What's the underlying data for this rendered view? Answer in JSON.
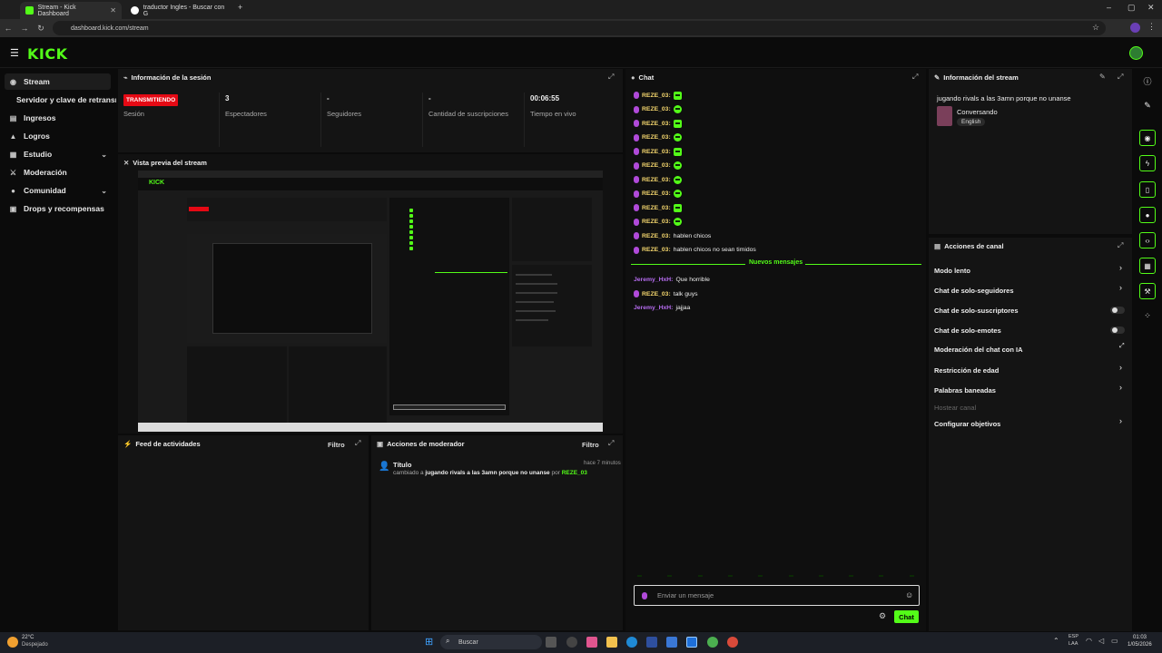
{
  "browser": {
    "tabs": [
      {
        "title": "Stream - Kick Dashboard",
        "active": true
      },
      {
        "title": "traductor Ingles - Buscar con G",
        "active": false
      }
    ],
    "url": "dashboard.kick.com/stream"
  },
  "app": {
    "logo": "KICK"
  },
  "sidebar": {
    "items": [
      {
        "label": "Stream",
        "icon": "broadcast-icon",
        "active": true
      },
      {
        "label": "Servidor y clave de retransmisión",
        "icon": "",
        "active": false
      },
      {
        "label": "Ingresos",
        "icon": "wallet-icon"
      },
      {
        "label": "Logros",
        "icon": "trophy-icon"
      },
      {
        "label": "Estudio",
        "icon": "studio-icon",
        "chevron": true
      },
      {
        "label": "Moderación",
        "icon": "sword-icon"
      },
      {
        "label": "Comunidad",
        "icon": "people-icon",
        "chevron": true
      },
      {
        "label": "Drops y recompensas",
        "icon": "gift-icon"
      }
    ]
  },
  "session": {
    "title": "Información de la sesión",
    "status_badge": "TRANSMITIENDO",
    "status_label": "Sesión",
    "stats": [
      {
        "value": "3",
        "label": "Espectadores"
      },
      {
        "value": "-",
        "label": "Seguidores"
      },
      {
        "value": "-",
        "label": "Cantidad de suscripciones"
      },
      {
        "value": "00:06:55",
        "label": "Tiempo en vivo"
      }
    ]
  },
  "preview": {
    "title": "Vista previa del stream"
  },
  "activity": {
    "title": "Feed de actividades",
    "filter": "Filtro"
  },
  "modactions": {
    "title": "Acciones de moderador",
    "filter": "Filtro",
    "entry": {
      "heading": "Título",
      "time": "hace 7 minutos",
      "prefix": "cambiado a",
      "value": "jugando rivals a las 3amn porque no unanse",
      "by": "por",
      "user": "REZE_03"
    }
  },
  "chat": {
    "title": "Chat",
    "messages": [
      {
        "user": "REZE_03:",
        "text": "",
        "emote": "sq"
      },
      {
        "user": "REZE_03:",
        "text": "",
        "emote": "round"
      },
      {
        "user": "REZE_03:",
        "text": "",
        "emote": "sq"
      },
      {
        "user": "REZE_03:",
        "text": "",
        "emote": "round"
      },
      {
        "user": "REZE_03:",
        "text": "",
        "emote": "sq"
      },
      {
        "user": "REZE_03:",
        "text": "",
        "emote": "round"
      },
      {
        "user": "REZE_03:",
        "text": "",
        "emote": "round"
      },
      {
        "user": "REZE_03:",
        "text": "",
        "emote": "round"
      },
      {
        "user": "REZE_03:",
        "text": "",
        "emote": "sq"
      },
      {
        "user": "REZE_03:",
        "text": "",
        "emote": "round"
      },
      {
        "user": "REZE_03:",
        "text": "hablen chicos"
      },
      {
        "user": "REZE_03:",
        "text": "hablen chicos no sean timidos"
      }
    ],
    "new_messages_label": "Nuevos mensajes",
    "new_messages": [
      {
        "user": "Jeremy_HxH:",
        "text": "Que horrible",
        "style": "purple"
      },
      {
        "user": "REZE_03:",
        "text": "talk guys",
        "style": "gold"
      },
      {
        "user": "Jeremy_HxH:",
        "text": "jajjaa",
        "style": "purple"
      }
    ],
    "input_placeholder": "Enviar un mensaje",
    "send_label": "Chat"
  },
  "stream_info": {
    "title": "Información del stream",
    "stream_title": "jugando rivals a las 3amn porque no unanse",
    "category": "Conversando",
    "language": "English"
  },
  "channel_actions": {
    "title": "Acciones de canal",
    "items": [
      {
        "label": "Modo lento",
        "control": "chevron"
      },
      {
        "label": "Chat de solo-seguidores",
        "control": "chevron"
      },
      {
        "label": "Chat de solo-suscriptores",
        "control": "toggle"
      },
      {
        "label": "Chat de solo-emotes",
        "control": "toggle"
      },
      {
        "label": "Moderación del chat con IA",
        "control": "external"
      },
      {
        "label": "Restricción de edad",
        "control": "chevron"
      },
      {
        "label": "Palabras baneadas",
        "control": "chevron"
      },
      {
        "label": "Hostear canal",
        "control": "none",
        "muted": true
      },
      {
        "label": "Configurar objetivos",
        "control": "chevron"
      }
    ]
  },
  "taskbar": {
    "weather_temp": "22°C",
    "weather_desc": "Despejado",
    "search": "Buscar",
    "lang_line1": "ESP",
    "lang_line2": "LAA",
    "time": "01:03",
    "date": "1/05/2026"
  },
  "colors": {
    "accent": "#53fc18",
    "live": "#e50914",
    "chat_user": "#f5d76e",
    "chat_user_alt": "#b66cf0"
  }
}
